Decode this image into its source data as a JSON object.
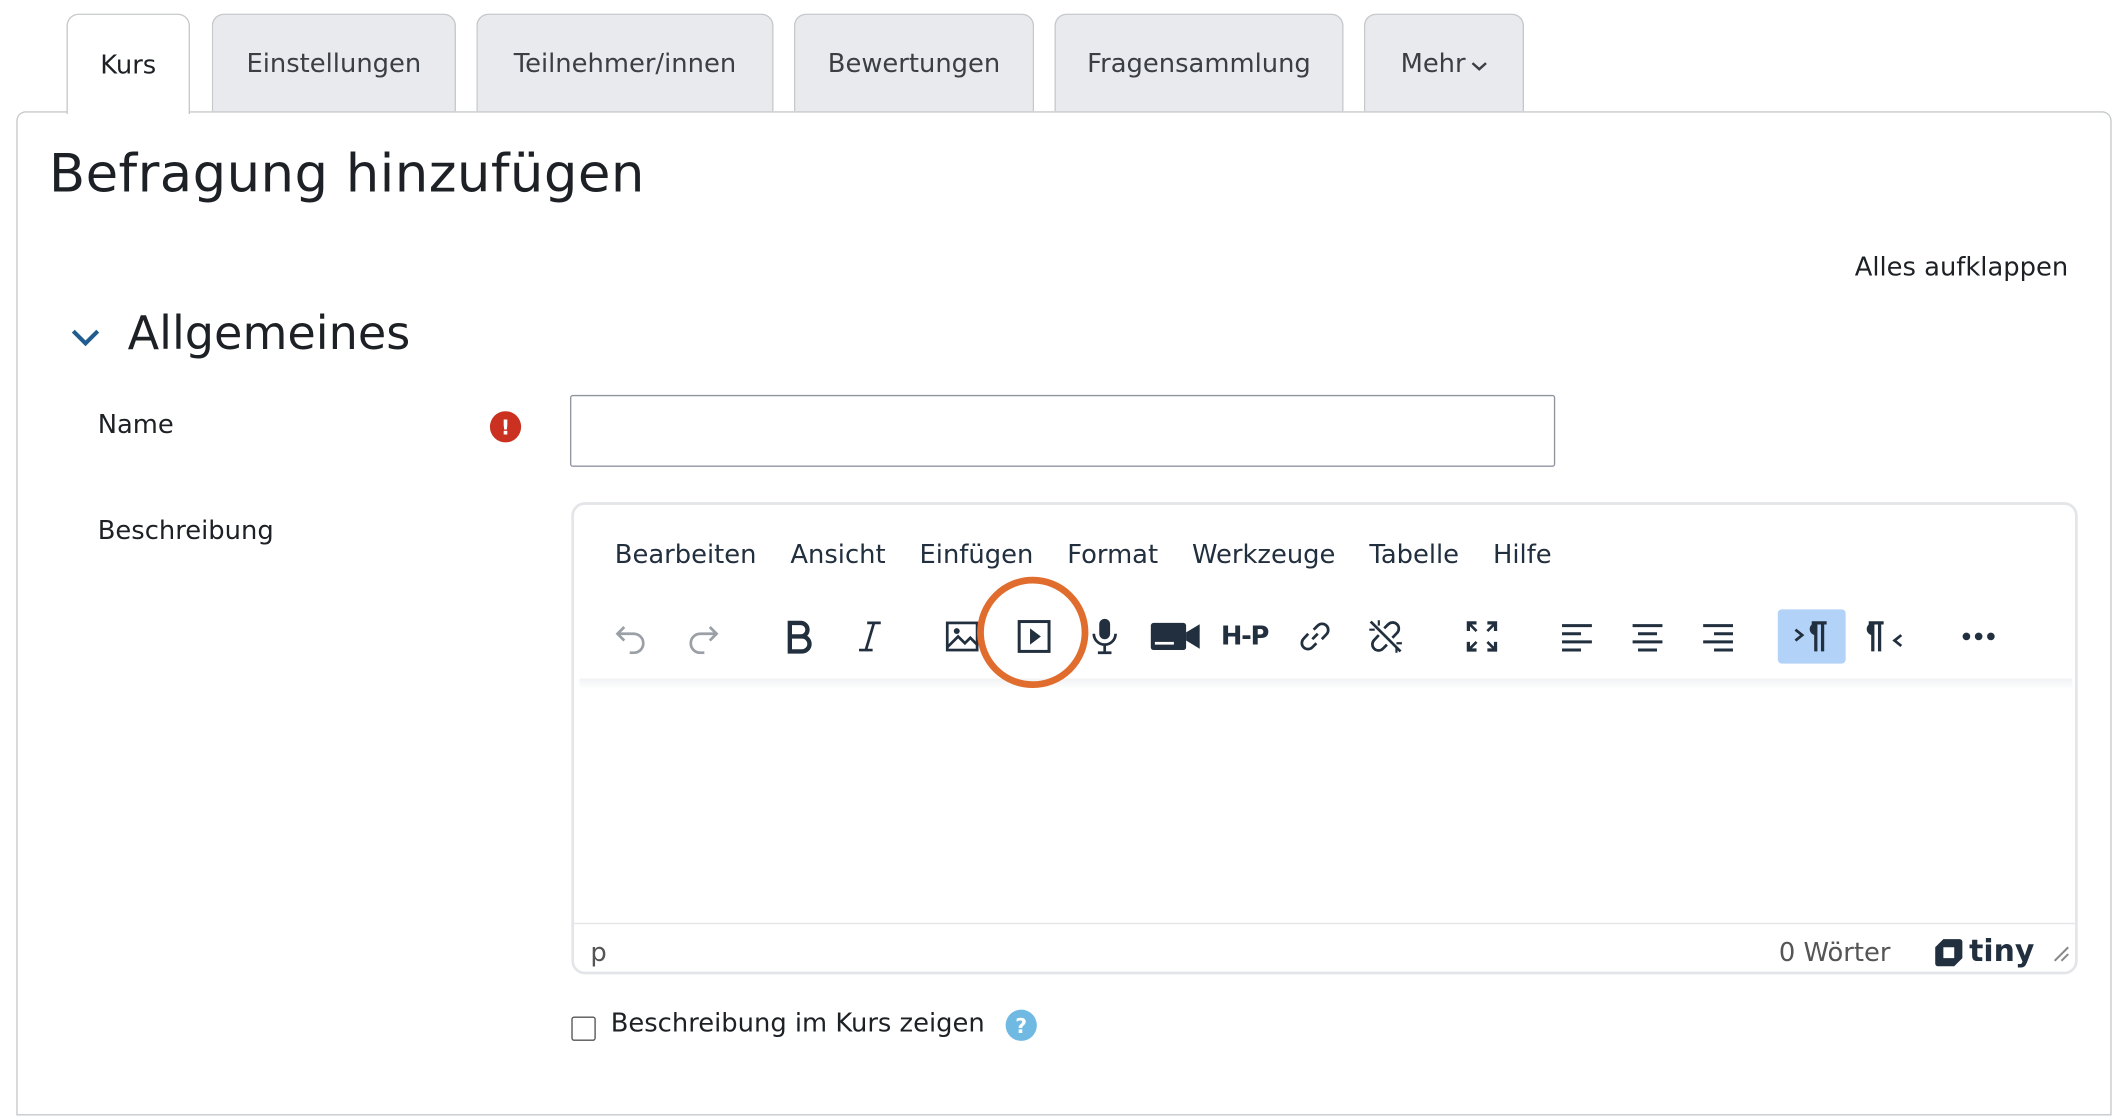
{
  "tabs": [
    {
      "label": "Kurs",
      "active": true
    },
    {
      "label": "Einstellungen"
    },
    {
      "label": "Teilnehmer/innen"
    },
    {
      "label": "Bewertungen"
    },
    {
      "label": "Fragensammlung"
    },
    {
      "label": "Mehr"
    }
  ],
  "page": {
    "title": "Befragung hinzufügen",
    "expand_all": "Alles aufklappen"
  },
  "section": {
    "title": "Allgemeines"
  },
  "form": {
    "name_label": "Name",
    "name_value": "",
    "required_icon": "!",
    "description_label": "Beschreibung",
    "show_description_label": "Beschreibung im Kurs zeigen",
    "help_icon": "?"
  },
  "editor": {
    "menu": [
      "Bearbeiten",
      "Ansicht",
      "Einfügen",
      "Format",
      "Werkzeuge",
      "Tabelle",
      "Hilfe"
    ],
    "toolbar_icons": [
      "undo-icon",
      "redo-icon",
      "bold-icon",
      "italic-icon",
      "image-icon",
      "media-icon",
      "microphone-icon",
      "video-camera-icon",
      "h5p-icon",
      "link-icon",
      "unlink-icon",
      "fullscreen-icon",
      "align-left-icon",
      "align-center-icon",
      "align-right-icon",
      "ltr-icon",
      "rtl-icon",
      "more-icon"
    ],
    "h5p_text": "H-P",
    "status_path": "p",
    "word_count": "0 Wörter",
    "brand": "tiny"
  },
  "colors": {
    "required": "#ca3120",
    "help": "#6fb9e3",
    "highlight_ring": "#e06d2e",
    "active_button": "#b3d2f7"
  }
}
